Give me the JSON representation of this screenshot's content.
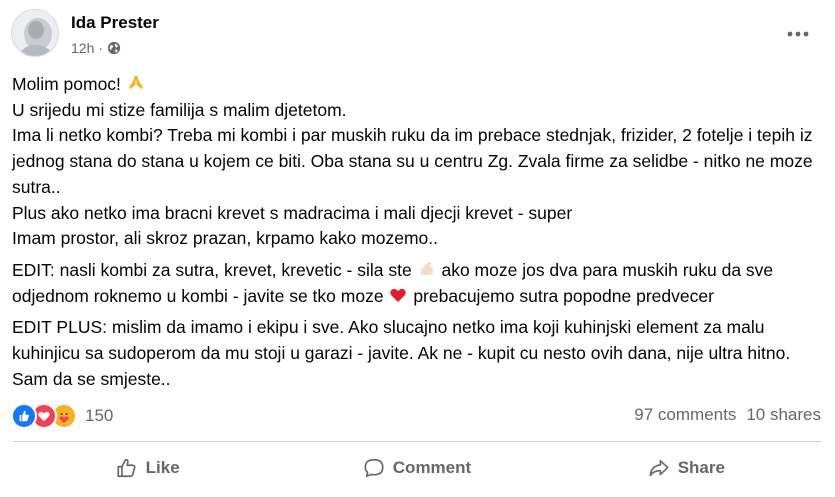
{
  "post": {
    "author": "Ida Prester",
    "time": "12h",
    "privacy_icon": "globe-icon",
    "paragraphs": [
      {
        "lines": [
          "Molim pomoc!",
          "U srijedu mi stize familija s malim djetetom.",
          "Ima li netko kombi? Treba mi kombi i par muskih ruku da im prebace stednjak, frizider, 2 fotelje i tepih iz jednog stana do stana u kojem ce biti. Oba stana su u centru Zg. Zvala firme za selidbe - nitko ne moze sutra..",
          "Plus ako netko ima bracni krevet s madracima i mali djecji krevet - super",
          "Imam prostor, ali skroz prazan, krpamo kako mozemo.."
        ]
      },
      {
        "edit_part1": "EDIT: nasli kombi za sutra, krevet, krevetic - sila ste",
        "edit_part2": "ako moze jos dva para muskih ruku da sve odjednom roknemo u kombi - javite se tko moze",
        "edit_part3": "prebacujemo sutra popodne predvecer"
      },
      {
        "text": "EDIT PLUS: mislim da imamo i ekipu i sve. Ako slucajno netko ima koji kuhinjski element za malu kuhinjicu sa sudoperom da mu stoji u garazi - javite. Ak ne - kupit cu nesto ovih dana, nije ultra hitno. Sam da se smjeste.."
      }
    ]
  },
  "stats": {
    "reaction_count": "150",
    "comments": "97 comments",
    "shares": "10 shares",
    "reaction_icons": [
      "like-icon",
      "love-icon",
      "care-icon"
    ]
  },
  "actions": {
    "like": "Like",
    "comment": "Comment",
    "share": "Share"
  },
  "colors": {
    "secondary_text": "#65676b",
    "like_blue": "#1877f2",
    "love_red": "#f33e58",
    "divider": "#ced0d4"
  }
}
